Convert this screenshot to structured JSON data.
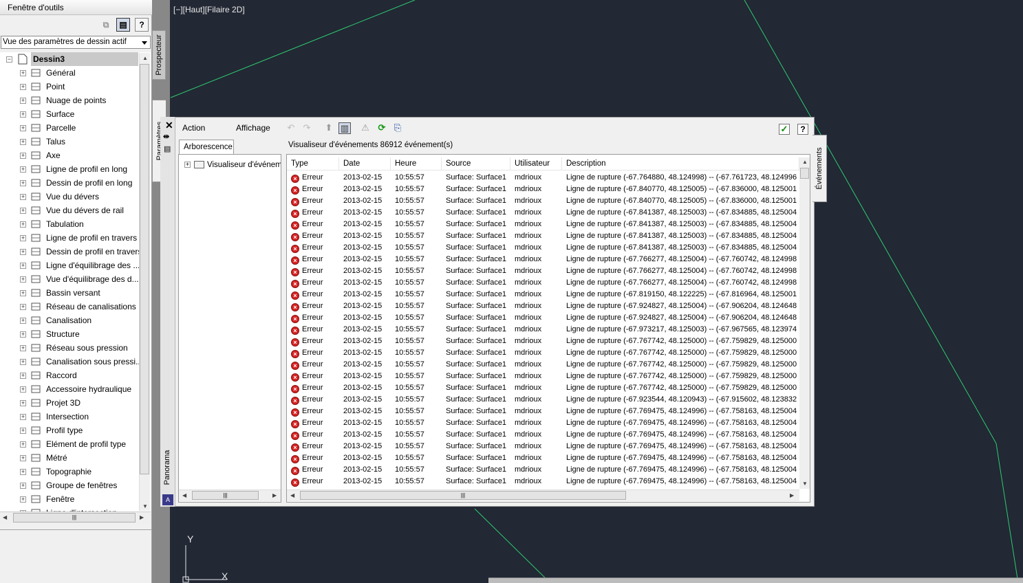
{
  "viewport": {
    "label": "[−][Haut][Filaire 2D]",
    "ucs_x": "X",
    "ucs_y": "Y",
    "line_color": "#2ecc71",
    "background": "#222834"
  },
  "toolspace": {
    "title": "Fenêtre d'outils",
    "help_label": "?",
    "view_select": "Vue des paramètres de dessin actif",
    "tabs": {
      "prospecteur": "Prospecteur",
      "parametres": "Paramètres"
    },
    "tree": {
      "root": "Dessin3",
      "items": [
        {
          "label": "Général",
          "icon": "general-icon"
        },
        {
          "label": "Point",
          "icon": "point-icon"
        },
        {
          "label": "Nuage de points",
          "icon": "point-cloud-icon"
        },
        {
          "label": "Surface",
          "icon": "surface-icon"
        },
        {
          "label": "Parcelle",
          "icon": "parcel-icon"
        },
        {
          "label": "Talus",
          "icon": "grading-icon"
        },
        {
          "label": "Axe",
          "icon": "alignment-icon"
        },
        {
          "label": "Ligne de profil en long",
          "icon": "profile-icon"
        },
        {
          "label": "Dessin de profil en long",
          "icon": "profile-view-icon"
        },
        {
          "label": "Vue du dévers",
          "icon": "superelevation-view-icon"
        },
        {
          "label": "Vue du dévers de rail",
          "icon": "rail-cant-view-icon"
        },
        {
          "label": "Tabulation",
          "icon": "sample-line-icon"
        },
        {
          "label": "Ligne de profil en travers",
          "icon": "section-icon"
        },
        {
          "label": "Dessin de profil en travers",
          "icon": "section-view-icon"
        },
        {
          "label": "Ligne d'équilibrage des ...",
          "icon": "mass-haul-line-icon"
        },
        {
          "label": "Vue d'équilibrage des d...",
          "icon": "mass-haul-view-icon"
        },
        {
          "label": "Bassin versant",
          "icon": "catchment-icon"
        },
        {
          "label": "Réseau de canalisations",
          "icon": "pipe-network-icon"
        },
        {
          "label": "Canalisation",
          "icon": "pipe-icon"
        },
        {
          "label": "Structure",
          "icon": "structure-icon"
        },
        {
          "label": "Réseau sous pression",
          "icon": "pressure-network-icon"
        },
        {
          "label": "Canalisation sous pressi...",
          "icon": "pressure-pipe-icon"
        },
        {
          "label": "Raccord",
          "icon": "fitting-icon"
        },
        {
          "label": "Accessoire hydraulique",
          "icon": "appurtenance-icon"
        },
        {
          "label": "Projet 3D",
          "icon": "corridor-icon"
        },
        {
          "label": "Intersection",
          "icon": "intersection-icon"
        },
        {
          "label": "Profil type",
          "icon": "assembly-icon"
        },
        {
          "label": "Elément de profil type",
          "icon": "subassembly-icon"
        },
        {
          "label": "Métré",
          "icon": "quantity-takeoff-icon"
        },
        {
          "label": "Topographie",
          "icon": "survey-icon"
        },
        {
          "label": "Groupe de fenêtres",
          "icon": "view-frame-group-icon"
        },
        {
          "label": "Fenêtre",
          "icon": "view-frame-icon"
        },
        {
          "label": "Ligne d'intersection",
          "icon": "match-line-icon"
        }
      ]
    }
  },
  "panorama": {
    "label": "Panorama",
    "logo": "A",
    "menu": {
      "action": "Action",
      "affichage": "Affichage"
    },
    "events_tab": "Événements",
    "help_label": "?",
    "tree_tab": "Arborescence",
    "tree_item": "Visualiseur d'événements",
    "grid_title": "Visualiseur d'événements   86912 événement(s)",
    "columns": [
      "Type",
      "Date",
      "Heure",
      "Source",
      "Utilisateur",
      "Description"
    ],
    "rows": [
      {
        "type": "Erreur",
        "date": "2013-02-15",
        "time": "10:55:57",
        "source": "Surface: Surface1",
        "user": "mdrioux",
        "desc": "Ligne de rupture (-67.764880, 48.124998) -- (-67.761723, 48.124996"
      },
      {
        "type": "Erreur",
        "date": "2013-02-15",
        "time": "10:55:57",
        "source": "Surface: Surface1",
        "user": "mdrioux",
        "desc": "Ligne de rupture (-67.840770, 48.125005) -- (-67.836000, 48.125001"
      },
      {
        "type": "Erreur",
        "date": "2013-02-15",
        "time": "10:55:57",
        "source": "Surface: Surface1",
        "user": "mdrioux",
        "desc": "Ligne de rupture (-67.840770, 48.125005) -- (-67.836000, 48.125001"
      },
      {
        "type": "Erreur",
        "date": "2013-02-15",
        "time": "10:55:57",
        "source": "Surface: Surface1",
        "user": "mdrioux",
        "desc": "Ligne de rupture (-67.841387, 48.125003) -- (-67.834885, 48.125004"
      },
      {
        "type": "Erreur",
        "date": "2013-02-15",
        "time": "10:55:57",
        "source": "Surface: Surface1",
        "user": "mdrioux",
        "desc": "Ligne de rupture (-67.841387, 48.125003) -- (-67.834885, 48.125004"
      },
      {
        "type": "Erreur",
        "date": "2013-02-15",
        "time": "10:55:57",
        "source": "Surface: Surface1",
        "user": "mdrioux",
        "desc": "Ligne de rupture (-67.841387, 48.125003) -- (-67.834885, 48.125004"
      },
      {
        "type": "Erreur",
        "date": "2013-02-15",
        "time": "10:55:57",
        "source": "Surface: Surface1",
        "user": "mdrioux",
        "desc": "Ligne de rupture (-67.841387, 48.125003) -- (-67.834885, 48.125004"
      },
      {
        "type": "Erreur",
        "date": "2013-02-15",
        "time": "10:55:57",
        "source": "Surface: Surface1",
        "user": "mdrioux",
        "desc": "Ligne de rupture (-67.766277, 48.125004) -- (-67.760742, 48.124998"
      },
      {
        "type": "Erreur",
        "date": "2013-02-15",
        "time": "10:55:57",
        "source": "Surface: Surface1",
        "user": "mdrioux",
        "desc": "Ligne de rupture (-67.766277, 48.125004) -- (-67.760742, 48.124998"
      },
      {
        "type": "Erreur",
        "date": "2013-02-15",
        "time": "10:55:57",
        "source": "Surface: Surface1",
        "user": "mdrioux",
        "desc": "Ligne de rupture (-67.766277, 48.125004) -- (-67.760742, 48.124998"
      },
      {
        "type": "Erreur",
        "date": "2013-02-15",
        "time": "10:55:57",
        "source": "Surface: Surface1",
        "user": "mdrioux",
        "desc": "Ligne de rupture (-67.819150, 48.122225) -- (-67.816964, 48.125001"
      },
      {
        "type": "Erreur",
        "date": "2013-02-15",
        "time": "10:55:57",
        "source": "Surface: Surface1",
        "user": "mdrioux",
        "desc": "Ligne de rupture (-67.924827, 48.125004) -- (-67.906204, 48.124648"
      },
      {
        "type": "Erreur",
        "date": "2013-02-15",
        "time": "10:55:57",
        "source": "Surface: Surface1",
        "user": "mdrioux",
        "desc": "Ligne de rupture (-67.924827, 48.125004) -- (-67.906204, 48.124648"
      },
      {
        "type": "Erreur",
        "date": "2013-02-15",
        "time": "10:55:57",
        "source": "Surface: Surface1",
        "user": "mdrioux",
        "desc": "Ligne de rupture (-67.973217, 48.125003) -- (-67.967565, 48.123974"
      },
      {
        "type": "Erreur",
        "date": "2013-02-15",
        "time": "10:55:57",
        "source": "Surface: Surface1",
        "user": "mdrioux",
        "desc": "Ligne de rupture (-67.767742, 48.125000) -- (-67.759829, 48.125000"
      },
      {
        "type": "Erreur",
        "date": "2013-02-15",
        "time": "10:55:57",
        "source": "Surface: Surface1",
        "user": "mdrioux",
        "desc": "Ligne de rupture (-67.767742, 48.125000) -- (-67.759829, 48.125000"
      },
      {
        "type": "Erreur",
        "date": "2013-02-15",
        "time": "10:55:57",
        "source": "Surface: Surface1",
        "user": "mdrioux",
        "desc": "Ligne de rupture (-67.767742, 48.125000) -- (-67.759829, 48.125000"
      },
      {
        "type": "Erreur",
        "date": "2013-02-15",
        "time": "10:55:57",
        "source": "Surface: Surface1",
        "user": "mdrioux",
        "desc": "Ligne de rupture (-67.767742, 48.125000) -- (-67.759829, 48.125000"
      },
      {
        "type": "Erreur",
        "date": "2013-02-15",
        "time": "10:55:57",
        "source": "Surface: Surface1",
        "user": "mdrioux",
        "desc": "Ligne de rupture (-67.767742, 48.125000) -- (-67.759829, 48.125000"
      },
      {
        "type": "Erreur",
        "date": "2013-02-15",
        "time": "10:55:57",
        "source": "Surface: Surface1",
        "user": "mdrioux",
        "desc": "Ligne de rupture (-67.923544, 48.120943) -- (-67.915602, 48.123832"
      },
      {
        "type": "Erreur",
        "date": "2013-02-15",
        "time": "10:55:57",
        "source": "Surface: Surface1",
        "user": "mdrioux",
        "desc": "Ligne de rupture (-67.769475, 48.124996) -- (-67.758163, 48.125004"
      },
      {
        "type": "Erreur",
        "date": "2013-02-15",
        "time": "10:55:57",
        "source": "Surface: Surface1",
        "user": "mdrioux",
        "desc": "Ligne de rupture (-67.769475, 48.124996) -- (-67.758163, 48.125004"
      },
      {
        "type": "Erreur",
        "date": "2013-02-15",
        "time": "10:55:57",
        "source": "Surface: Surface1",
        "user": "mdrioux",
        "desc": "Ligne de rupture (-67.769475, 48.124996) -- (-67.758163, 48.125004"
      },
      {
        "type": "Erreur",
        "date": "2013-02-15",
        "time": "10:55:57",
        "source": "Surface: Surface1",
        "user": "mdrioux",
        "desc": "Ligne de rupture (-67.769475, 48.124996) -- (-67.758163, 48.125004"
      },
      {
        "type": "Erreur",
        "date": "2013-02-15",
        "time": "10:55:57",
        "source": "Surface: Surface1",
        "user": "mdrioux",
        "desc": "Ligne de rupture (-67.769475, 48.124996) -- (-67.758163, 48.125004"
      },
      {
        "type": "Erreur",
        "date": "2013-02-15",
        "time": "10:55:57",
        "source": "Surface: Surface1",
        "user": "mdrioux",
        "desc": "Ligne de rupture (-67.769475, 48.124996) -- (-67.758163, 48.125004"
      },
      {
        "type": "Erreur",
        "date": "2013-02-15",
        "time": "10:55:57",
        "source": "Surface: Surface1",
        "user": "mdrioux",
        "desc": "Ligne de rupture (-67.769475, 48.124996) -- (-67.758163, 48.125004"
      }
    ]
  }
}
